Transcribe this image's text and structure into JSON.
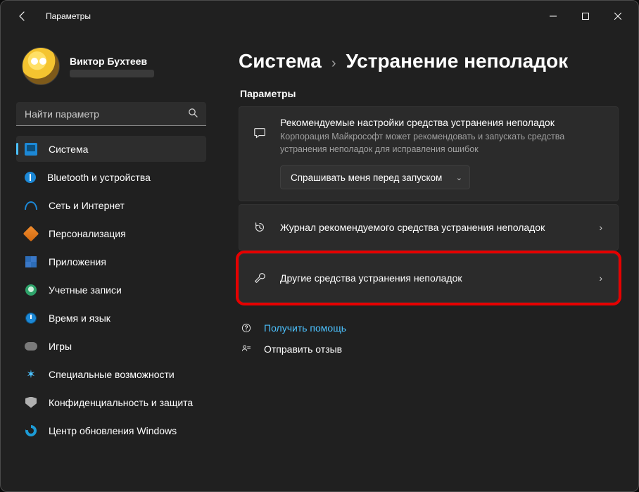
{
  "window": {
    "title": "Параметры"
  },
  "user": {
    "name": "Виктор Бухтеев"
  },
  "search": {
    "placeholder": "Найти параметр"
  },
  "nav": {
    "system": "Система",
    "bluetooth": "Bluetooth и устройства",
    "network": "Сеть и Интернет",
    "personal": "Персонализация",
    "apps": "Приложения",
    "accounts": "Учетные записи",
    "time": "Время и язык",
    "gaming": "Игры",
    "access": "Специальные возможности",
    "privacy": "Конфиденциальность и защита",
    "update": "Центр обновления Windows"
  },
  "breadcrumb": {
    "parent": "Система",
    "sep": "›",
    "current": "Устранение неполадок"
  },
  "main": {
    "section_label": "Параметры",
    "recommended": {
      "title": "Рекомендуемые настройки средства устранения неполадок",
      "desc": "Корпорация Майкрософт может рекомендовать и запускать средства устранения неполадок для исправления ошибок",
      "dropdown_value": "Спрашивать меня перед запуском"
    },
    "history_row": "Журнал рекомендуемого средства устранения неполадок",
    "other_row": "Другие средства устранения неполадок"
  },
  "footer": {
    "help": "Получить помощь",
    "feedback": "Отправить отзыв"
  }
}
